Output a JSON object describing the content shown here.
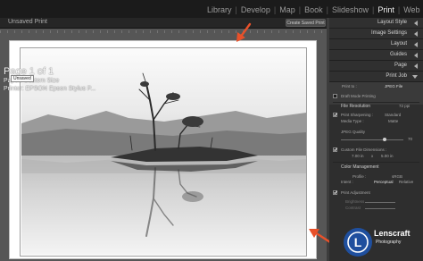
{
  "modules": [
    "Library",
    "Develop",
    "Map",
    "Book",
    "Slideshow",
    "Print",
    "Web"
  ],
  "active_module": "Print",
  "toolbar": {
    "unsaved_label": "Unsaved Print",
    "create_saved_print": "Create Saved Print"
  },
  "canvas": {
    "page": "Page 1 of 1",
    "paper": "Paper:  Custom Size",
    "printer": "Printer:  EPSON Epson Stylus P...",
    "tooltip": "Unsaved"
  },
  "panel_sections": [
    {
      "label": "Layout Style",
      "state": "collapsed"
    },
    {
      "label": "Image Settings",
      "state": "collapsed"
    },
    {
      "label": "Layout",
      "state": "collapsed"
    },
    {
      "label": "Guides",
      "state": "collapsed"
    },
    {
      "label": "Page",
      "state": "collapsed"
    },
    {
      "label": "Print Job",
      "state": "expanded"
    }
  ],
  "print_job": {
    "print_to_label": "Print to :",
    "print_to_value": "JPEG File",
    "draft_mode": "Draft Mode Printing",
    "file_resolution_label": "File Resolution",
    "file_resolution_value": "72 ppi",
    "print_sharpening_label": "Print Sharpening :",
    "print_sharpening_value": "Standard",
    "media_type_label": "Media Type :",
    "media_type_value": "Matte",
    "jpeg_quality_label": "JPEG Quality",
    "jpeg_quality_value": "70",
    "custom_dims_label": "Custom File Dimensions :",
    "dim_w": "7.00 in",
    "dim_x": "x",
    "dim_h": "5.00 in",
    "color_management": "Color Management",
    "profile_label": "Profile :",
    "profile_value": "sRGB",
    "intent_label": "Intent :",
    "intent_perceptual": "Perceptual",
    "intent_relative": "Relative",
    "print_adjustment": "Print Adjustment",
    "brightness": "Brightness",
    "contrast": "Contrast"
  },
  "logo": {
    "text": "Lenscraft",
    "subtext": "Photography",
    "mark": "L"
  },
  "colors": {
    "arrow": "#e8512a",
    "panel_bg": "#3a3a3a",
    "topbar_bg": "#1b1b1b",
    "canvas_bg": "#565656"
  }
}
